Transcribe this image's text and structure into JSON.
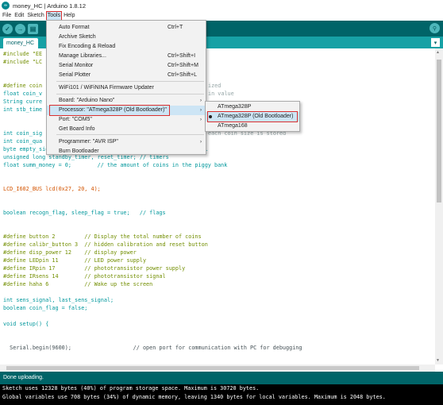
{
  "window": {
    "title": "money_HC | Arduino 1.8.12",
    "logo_text": "∞"
  },
  "menubar": [
    "File",
    "Edit",
    "Sketch",
    "Tools",
    "Help"
  ],
  "toolbar": {
    "verify_icon": "check-icon",
    "upload_icon": "arrow-right-icon",
    "new_icon": "new-file-icon",
    "open_icon": "open-icon",
    "save_icon": "save-icon",
    "serial_icon": "magnifier-icon"
  },
  "file_tab": {
    "label": "money_HC",
    "menu_glyph": "▾"
  },
  "editor": {
    "lines": [
      "#include \"EE",
      "#include \"LC",
      "",
      "",
      "#define coin",
      "float coin_v",
      "String curre",
      "int stb_time",
      "",
      "",
      "int coin_sig",
      "int coin_qua",
      "byte empty_signal;           // store the level of empty signal",
      "unsigned long standby_timer, reset_timer; // timers",
      "float summ_money = 0;        // the amount of coins in the piggy bank",
      "",
      "",
      "LCD_I602_BUS lcd(0x27, 20, 4);",
      "",
      "",
      "boolean recogn_flag, sleep_flag = true;   // flags",
      "",
      "",
      "#define button 2         // Display the total number of coins",
      "#define calibr_button 3  // hidden calibration and reset button",
      "#define disp_power 12    // display power",
      "#define LEDpin 11        // LED power supply",
      "#define IRpin 17         // phototransistor power supply",
      "#define IRsens 14        // phototransistor signal",
      "#define haha 6           // Wake up the screen",
      "",
      "int sens_signal, last_sens_signal;",
      "boolean coin_flag = false;",
      "",
      "void setup() {",
      "",
      "",
      "  Serial.begin(9600);                   // open port for communication with PC for debugging"
    ],
    "partial_right": [
      {
        "row": 4,
        "text": "ized"
      },
      {
        "row": 5,
        "text": "in value"
      },
      {
        "row": 10,
        "text": "each coin size is stored"
      }
    ]
  },
  "tools_menu": {
    "items": [
      {
        "label": "Auto Format",
        "shortcut": "Ctrl+T"
      },
      {
        "label": "Archive Sketch",
        "shortcut": ""
      },
      {
        "label": "Fix Encoding & Reload",
        "shortcut": ""
      },
      {
        "label": "Manage Libraries...",
        "shortcut": "Ctrl+Shift+I"
      },
      {
        "label": "Serial Monitor",
        "shortcut": "Ctrl+Shift+M"
      },
      {
        "label": "Serial Plotter",
        "shortcut": "Ctrl+Shift+L"
      },
      {
        "label": "WiFi101 / WiFiNINA Firmware Updater",
        "shortcut": ""
      },
      {
        "label": "Board: \"Arduino Nano\"",
        "shortcut": ""
      },
      {
        "label": "Processor: \"ATmega328P (Old Bootloader)\"",
        "shortcut": ""
      },
      {
        "label": "Port: \"COM5\"",
        "shortcut": ""
      },
      {
        "label": "Get Board Info",
        "shortcut": ""
      },
      {
        "label": "Programmer: \"AVR ISP\"",
        "shortcut": ""
      },
      {
        "label": "Burn Bootloader",
        "shortcut": ""
      }
    ],
    "submenu_arrow": "›"
  },
  "processor_submenu": {
    "items": [
      {
        "label": "ATmega328P",
        "selected": false
      },
      {
        "label": "ATmega328P (Old Bootloader)",
        "selected": true
      },
      {
        "label": "ATmega168",
        "selected": false
      }
    ]
  },
  "status": {
    "text": "Done uploading."
  },
  "console": {
    "lines": [
      "Sketch uses 12328 bytes (40%) of program storage space. Maximum is 30720 bytes.",
      "Global variables use 708 bytes (34%) of dynamic memory, leaving 1340 bytes for local variables. Maximum is 2048 bytes."
    ]
  },
  "colors": {
    "toolbar": "#006468",
    "tabbar": "#17a1a5",
    "highlight": "#cde5f5",
    "annotation": "#d93030"
  }
}
